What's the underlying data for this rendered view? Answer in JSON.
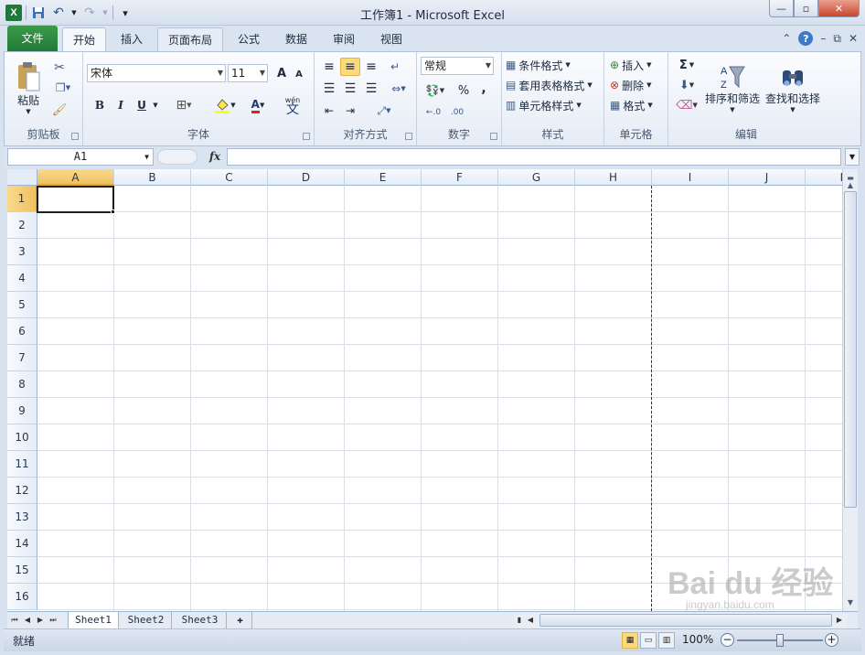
{
  "window": {
    "title": "工作簿1 - Microsoft Excel",
    "app_icon": "excel-icon",
    "minimize": "—",
    "maximize": "▫",
    "close": "✕"
  },
  "qat": {
    "app_letter": "X",
    "save": "💾",
    "undo": "↶",
    "redo": "↷",
    "customize": "▾"
  },
  "tabs": [
    {
      "label": "文件"
    },
    {
      "label": "开始"
    },
    {
      "label": "插入"
    },
    {
      "label": "页面布局"
    },
    {
      "label": "公式"
    },
    {
      "label": "数据"
    },
    {
      "label": "审阅"
    },
    {
      "label": "视图"
    }
  ],
  "ribbon": {
    "clipboard": {
      "label": "剪贴板",
      "paste": "粘贴"
    },
    "font": {
      "label": "字体",
      "font_name": "宋体",
      "font_size": "11",
      "bold": "B",
      "italic": "I",
      "underline": "U",
      "grow": "A",
      "shrink": "A",
      "font_color_letter": "A",
      "phonetic": "wén"
    },
    "alignment": {
      "label": "对齐方式"
    },
    "number": {
      "label": "数字",
      "format": "常规",
      "percent": "%",
      "comma": ",",
      "inc_decimal": "←.0",
      "dec_decimal": ".00"
    },
    "styles": {
      "label": "样式",
      "conditional": "条件格式",
      "table": "套用表格格式",
      "cell_styles": "单元格样式"
    },
    "cells": {
      "label": "单元格",
      "insert": "插入",
      "delete": "删除",
      "format": "格式"
    },
    "editing": {
      "label": "编辑",
      "sum": "Σ",
      "sort_filter": "排序和筛选",
      "find_select": "查找和选择"
    }
  },
  "formula_bar": {
    "name_box": "A1",
    "fx": "fx",
    "value": ""
  },
  "columns": [
    "A",
    "B",
    "C",
    "D",
    "E",
    "F",
    "G",
    "H",
    "I",
    "J",
    "K"
  ],
  "rows": [
    "1",
    "2",
    "3",
    "4",
    "5",
    "6",
    "7",
    "8",
    "9",
    "10",
    "11",
    "12",
    "13",
    "14",
    "15",
    "16"
  ],
  "sheets": [
    {
      "label": "Sheet1"
    },
    {
      "label": "Sheet2"
    },
    {
      "label": "Sheet3"
    }
  ],
  "status": {
    "ready": "就绪",
    "zoom": "100%"
  },
  "watermark": {
    "brand": "Bai du 经验",
    "url": "jingyan.baidu.com"
  }
}
